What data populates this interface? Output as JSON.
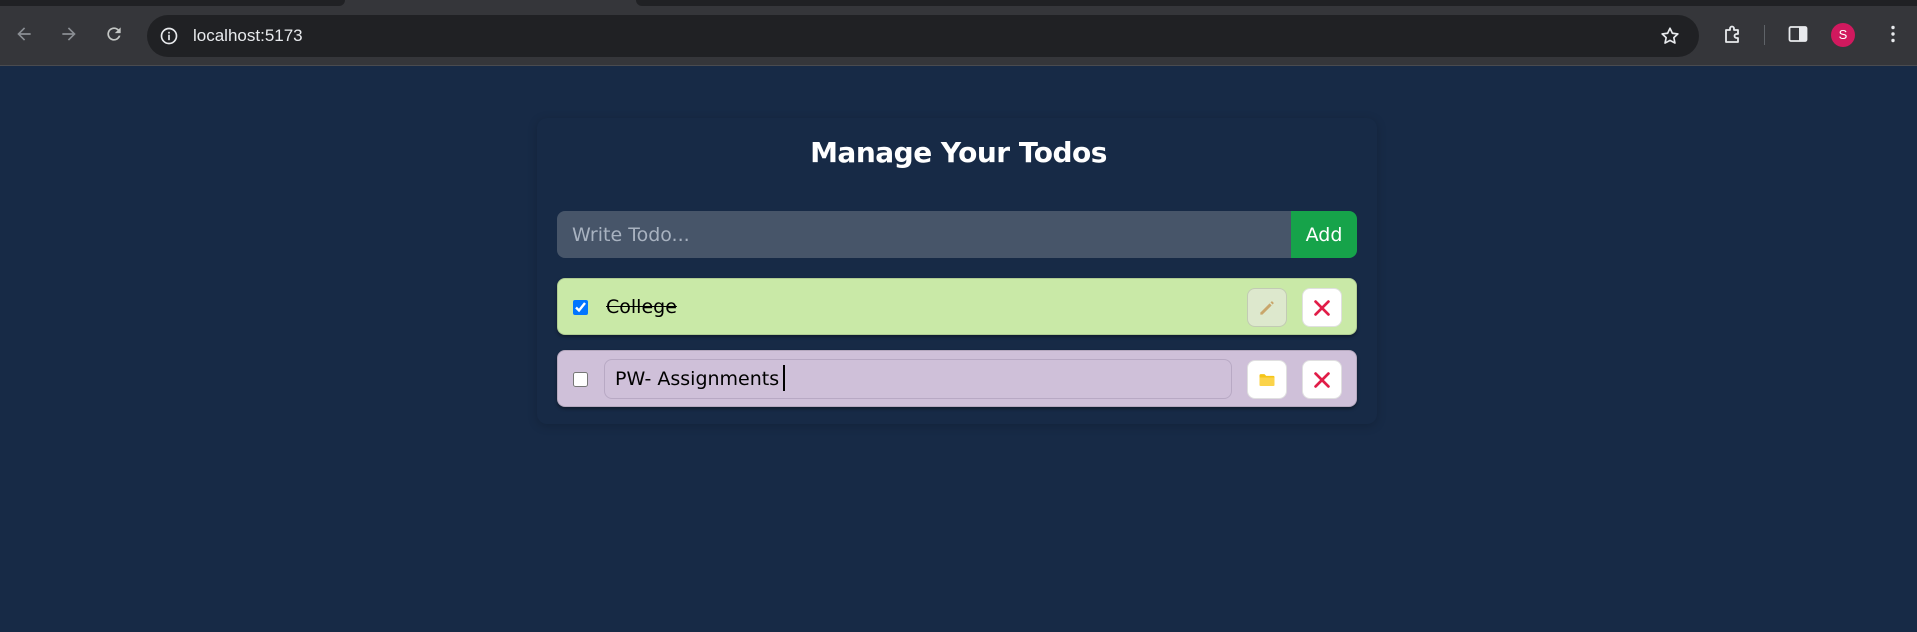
{
  "browser": {
    "url": "localhost:5173",
    "profile_initial": "S",
    "profile_color": "#d1195e",
    "icons": [
      "back-arrow-icon",
      "forward-arrow-icon",
      "reload-icon",
      "site-info-icon",
      "bookmark-star-icon",
      "extensions-icon",
      "side-panel-icon",
      "menu-kebab-icon"
    ]
  },
  "app": {
    "title": "Manage Your Todos",
    "form": {
      "placeholder": "Write Todo...",
      "add_label": "Add"
    },
    "todos": [
      {
        "text": "College",
        "completed": true,
        "editing": false,
        "background": "#c9e9a7",
        "edit_icon": "pencil-icon",
        "delete_icon": "close-x-icon"
      },
      {
        "text": "PW- Assignments",
        "completed": false,
        "editing": true,
        "background": "#cfc0d9",
        "edit_icon": "folder-save-icon",
        "delete_icon": "close-x-icon"
      }
    ]
  },
  "colors": {
    "page_background": "#172a46",
    "input_background": "#475569",
    "add_button": "#16a34a",
    "delete_icon": "#e11d48"
  }
}
